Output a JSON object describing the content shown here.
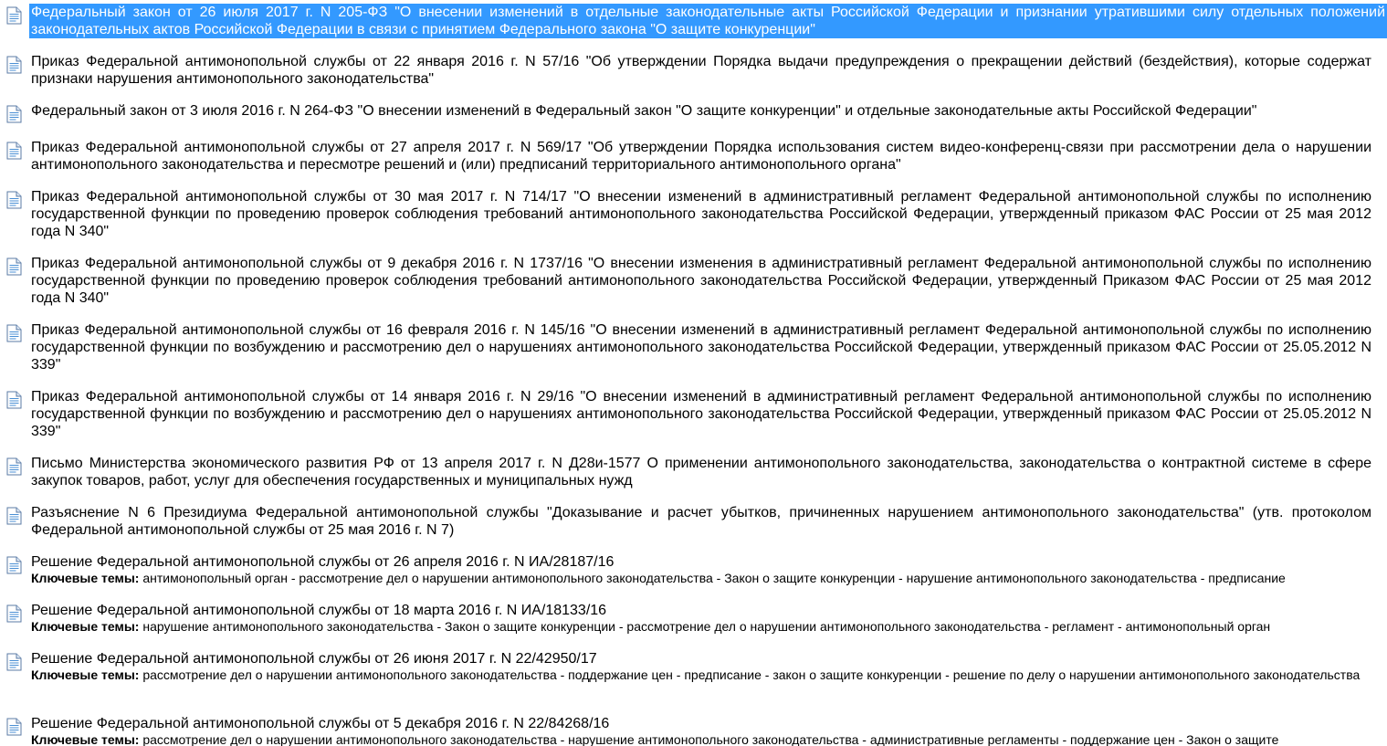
{
  "colors": {
    "selection_bg": "#3399ff",
    "selection_text": "#ffffff",
    "text": "#000000",
    "icon_fill": "#ffffff",
    "icon_border": "#5b7ba6",
    "icon_lines": "#4a8fd4"
  },
  "keywords_label": "Ключевые темы:",
  "items": [
    {
      "icon": "document-icon",
      "selected": true,
      "title": "Федеральный закон от 26 июля 2017 г. N 205-ФЗ \"О внесении изменений в отдельные законодательные акты Российской Федерации и признании утратившими силу отдельных положений законодательных актов Российской Федерации в связи с принятием Федерального закона \"О защите конкуренции\""
    },
    {
      "icon": "document-icon",
      "title": "Приказ Федеральной антимонопольной службы от 22 января 2016 г. N 57/16 \"Об утверждении Порядка выдачи предупреждения о прекращении действий (бездействия), которые содержат признаки нарушения антимонопольного законодательства\""
    },
    {
      "icon": "document-icon",
      "title": "Федеральный закон от 3 июля 2016 г. N 264-ФЗ \"О внесении изменений в Федеральный закон \"О защите конкуренции\" и отдельные законодательные акты Российской Федерации\""
    },
    {
      "icon": "document-icon",
      "title": "Приказ Федеральной антимонопольной службы от 27 апреля 2017 г. N 569/17 \"Об утверждении Порядка использования систем видео-конференц-связи при рассмотрении дела о нарушении антимонопольного законодательства и пересмотре решений и (или) предписаний территориального антимонопольного органа\""
    },
    {
      "icon": "document-icon",
      "title": "Приказ Федеральной антимонопольной службы от 30 мая 2017 г. N 714/17 \"О внесении изменений в административный регламент Федеральной антимонопольной службы по исполнению государственной функции по проведению проверок соблюдения требований антимонопольного законодательства Российской Федерации, утвержденный приказом ФАС России от 25 мая 2012 года N 340\""
    },
    {
      "icon": "document-icon",
      "title": "Приказ Федеральной антимонопольной службы от 9 декабря 2016 г. N 1737/16 \"О внесении изменения в административный регламент Федеральной антимонопольной службы по исполнению государственной функции по проведению проверок соблюдения требований антимонопольного законодательства Российской Федерации, утвержденный Приказом ФАС России от 25 мая 2012 года N 340\""
    },
    {
      "icon": "document-icon",
      "title": "Приказ Федеральной антимонопольной службы от 16 февраля 2016 г. N 145/16 \"О внесении изменений в административный регламент Федеральной антимонопольной службы по исполнению государственной функции по возбуждению и рассмотрению дел о нарушениях антимонопольного законодательства Российской Федерации, утвержденный приказом ФАС России от 25.05.2012 N 339\""
    },
    {
      "icon": "document-icon",
      "title": "Приказ Федеральной антимонопольной службы от 14 января 2016 г. N 29/16 \"О внесении изменений в административный регламент Федеральной антимонопольной службы по исполнению государственной функции по возбуждению и рассмотрению дел о нарушениях антимонопольного законодательства Российской Федерации, утвержденный приказом ФАС России от 25.05.2012 N 339\""
    },
    {
      "icon": "document-icon",
      "title": "Письмо Министерства экономического развития РФ от 13 апреля 2017 г. N Д28и-1577 О применении антимонопольного законодательства, законодательства о контрактной системе в сфере закупок товаров, работ, услуг для обеспечения государственных и муниципальных нужд"
    },
    {
      "icon": "document-icon",
      "title": "Разъяснение N 6 Президиума Федеральной антимонопольной службы \"Доказывание и расчет убытков, причиненных нарушением антимонопольного законодательства\" (утв. протоколом Федеральной антимонопольной службы от 25 мая 2016 г. N 7)"
    },
    {
      "icon": "document-icon",
      "title": "Решение Федеральной антимонопольной службы от 26 апреля 2016 г. N ИА/28187/16",
      "topics": "антимонопольный орган - рассмотрение дел о нарушении антимонопольного законодательства - Закон о защите конкуренции - нарушение антимонопольного законодательства - предписание"
    },
    {
      "icon": "document-icon",
      "title": "Решение Федеральной антимонопольной службы от 18 марта 2016 г. N ИА/18133/16",
      "topics": "нарушение антимонопольного законодательства - Закон о защите конкуренции - рассмотрение дел о нарушении антимонопольного законодательства - регламент - антимонопольный орган"
    },
    {
      "icon": "document-icon",
      "title": "Решение Федеральной антимонопольной службы от 26 июня 2017 г. N 22/42950/17",
      "topics": "рассмотрение дел о нарушении антимонопольного законодательства - поддержание цен - предписание - закон о защите конкуренции - решение по делу о нарушении антимонопольного законодательства"
    },
    {
      "icon": "document-icon",
      "title": "Решение Федеральной антимонопольной службы от 5 декабря 2016 г. N 22/84268/16",
      "topics": "рассмотрение дел о нарушении антимонопольного законодательства - нарушение антимонопольного законодательства - административные регламенты - поддержание цен - Закон о защите"
    }
  ]
}
